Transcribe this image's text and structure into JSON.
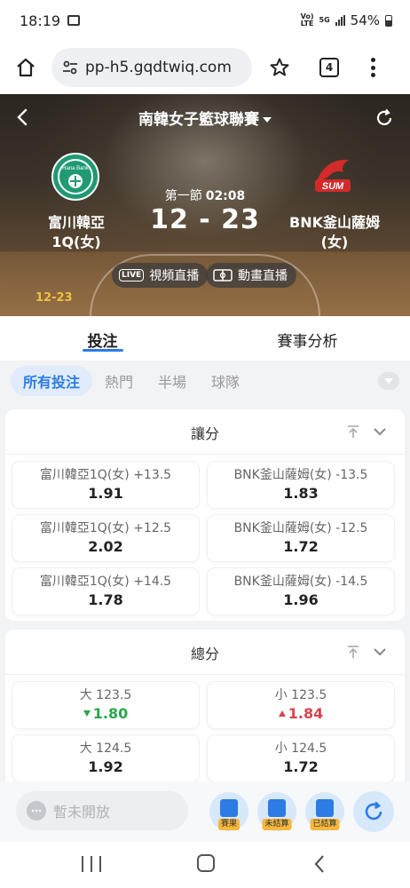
{
  "status": {
    "time": "18:19",
    "net1": "Vo)\nLTE",
    "net2": "5G",
    "battery": "54%"
  },
  "browser": {
    "url": "pp-h5.gqdtwiq.com",
    "tab_count": "4"
  },
  "match": {
    "league": "南韓女子籃球聯賽",
    "home_team_line1": "富川韓亞",
    "home_team_line2": "1Q(女)",
    "away_team_line1": "BNK釜山薩姆",
    "away_team_line2": "(女)",
    "period": "第一節",
    "clock": "02:08",
    "score": "12 - 23",
    "date": "12-23",
    "video_btn": "視頻直播",
    "anim_btn": "動畫直播",
    "live_badge": "LIVE",
    "home_logo_text": "Hana Bank"
  },
  "main_tabs": [
    "投注",
    "賽事分析"
  ],
  "filters": [
    "所有投注",
    "熱門",
    "半場",
    "球隊"
  ],
  "markets": [
    {
      "title": "讓分",
      "odds": [
        {
          "label": "富川韓亞1Q(女) +13.5",
          "value": "1.91",
          "trend": ""
        },
        {
          "label": "BNK釜山薩姆(女) -13.5",
          "value": "1.83",
          "trend": ""
        },
        {
          "label": "富川韓亞1Q(女) +12.5",
          "value": "2.02",
          "trend": ""
        },
        {
          "label": "BNK釜山薩姆(女) -12.5",
          "value": "1.72",
          "trend": ""
        },
        {
          "label": "富川韓亞1Q(女) +14.5",
          "value": "1.78",
          "trend": ""
        },
        {
          "label": "BNK釜山薩姆(女) -14.5",
          "value": "1.96",
          "trend": ""
        }
      ]
    },
    {
      "title": "總分",
      "odds": [
        {
          "label": "大 123.5",
          "value": "1.80",
          "trend": "down"
        },
        {
          "label": "小 123.5",
          "value": "1.84",
          "trend": "up"
        },
        {
          "label": "大 124.5",
          "value": "1.92",
          "trend": ""
        },
        {
          "label": "小 124.5",
          "value": "1.72",
          "trend": ""
        }
      ]
    }
  ],
  "actionbar": {
    "chat_placeholder": "暫未開放",
    "results_label": "賽果",
    "unsettled_label": "未結算",
    "settled_label": "已結算"
  },
  "colors": {
    "accent": "#2d7be5",
    "up": "#d9434c",
    "down": "#2aa84a",
    "home_logo": "#1f9a73",
    "away_logo": "#d42a2a"
  }
}
